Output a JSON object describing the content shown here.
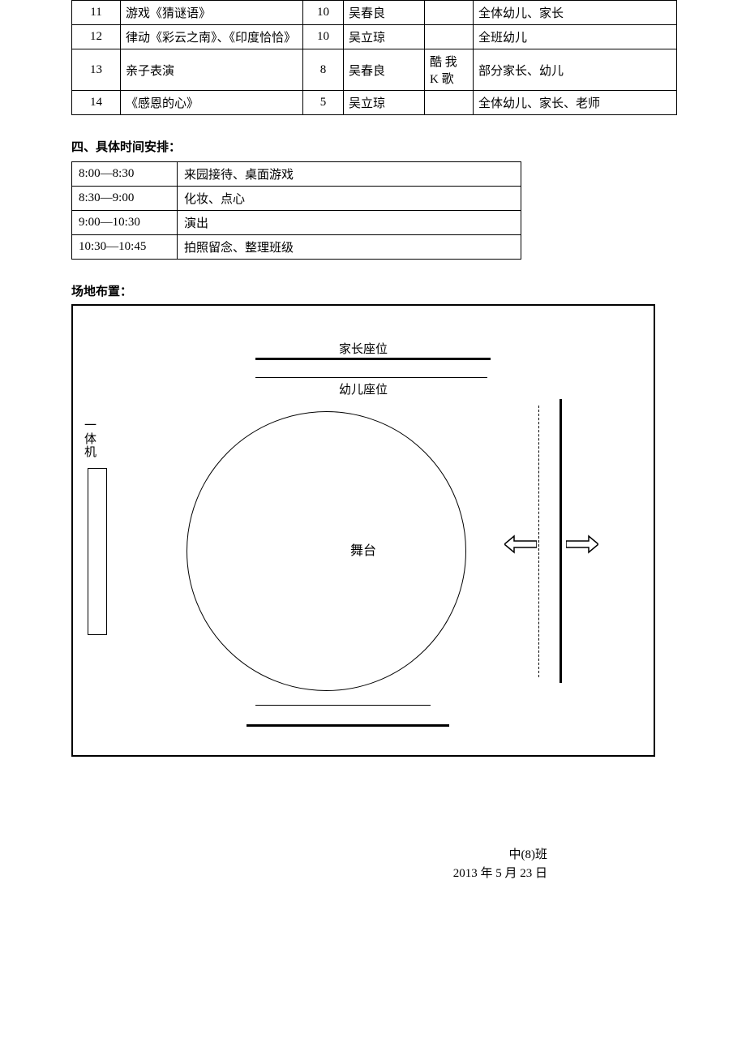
{
  "table1": {
    "rows": [
      {
        "no": "11",
        "item": "游戏《猜谜语》",
        "dur": "10",
        "host": "吴春良",
        "note": "",
        "aud": "全体幼儿、家长"
      },
      {
        "no": "12",
        "item": "律动《彩云之南》、《印度恰恰》",
        "dur": "10",
        "host": "吴立琼",
        "note": "",
        "aud": "全班幼儿"
      },
      {
        "no": "13",
        "item": "亲子表演",
        "dur": "8",
        "host": "吴春良",
        "note": "酷 我 K 歌",
        "aud": "部分家长、幼儿"
      },
      {
        "no": "14",
        "item": "《感恩的心》",
        "dur": "5",
        "host": "吴立琼",
        "note": "",
        "aud": "全体幼儿、家长、老师"
      }
    ]
  },
  "section_time_heading": "四、具体时间安排：",
  "table2": {
    "rows": [
      {
        "time": "8:00—8:30",
        "act": "来园接待、桌面游戏"
      },
      {
        "time": "8:30—9:00",
        "act": "化妆、点心"
      },
      {
        "time": "9:00—10:30",
        "act": "演出"
      },
      {
        "time": "10:30—10:45",
        "act": "拍照留念、整理班级"
      }
    ]
  },
  "venue_heading": "场地布置：",
  "venue": {
    "parent_seat": "家长座位",
    "child_seat": "幼儿座位",
    "pc": "一体机",
    "stage": "舞台"
  },
  "footer": {
    "class": "中(8)班",
    "date": "2013 年 5 月 23 日"
  }
}
